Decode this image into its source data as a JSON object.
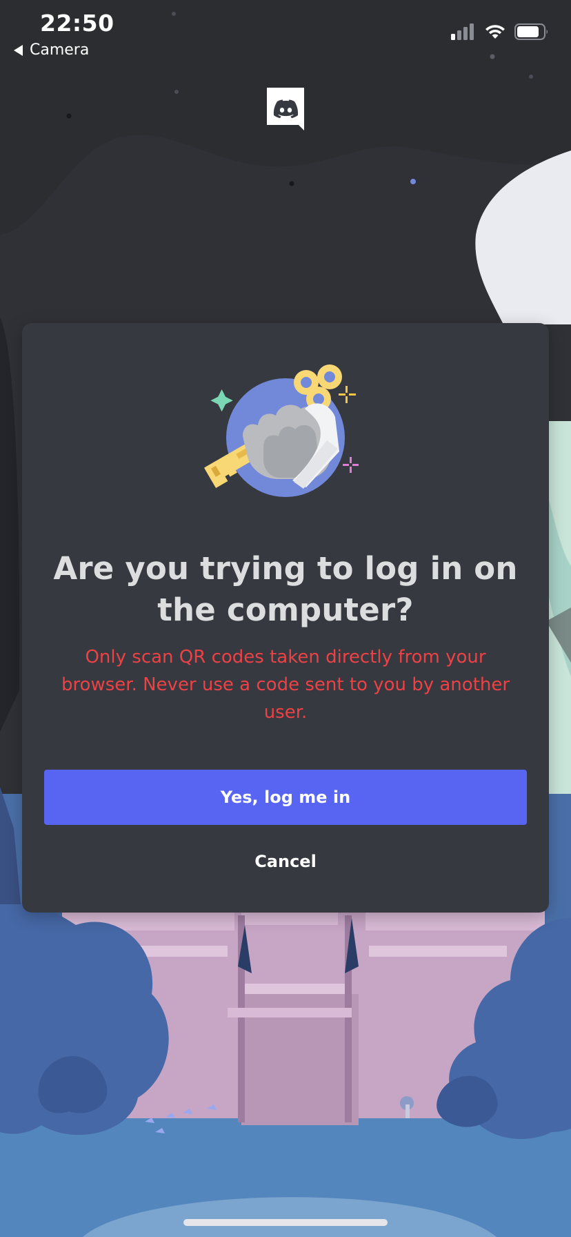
{
  "status_bar": {
    "time": "22:50",
    "back_label": "Camera",
    "signal_icon": "cellular-signal-icon",
    "wifi_icon": "wifi-icon",
    "battery_icon": "battery-icon"
  },
  "header": {
    "logo_icon": "discord-logo-icon"
  },
  "modal": {
    "illustration_icon": "hand-holding-key-icon",
    "title": "Are you trying to log in on the computer?",
    "warning": "Only scan QR codes taken directly from your browser. Never use a code sent to you by another user.",
    "confirm_label": "Yes, log me in",
    "cancel_label": "Cancel"
  },
  "colors": {
    "background_top": "#2f3136",
    "modal_background": "#36393f",
    "title_text": "#dcddde",
    "warning_text": "#ed4245",
    "brand_blurple": "#5865f2"
  }
}
